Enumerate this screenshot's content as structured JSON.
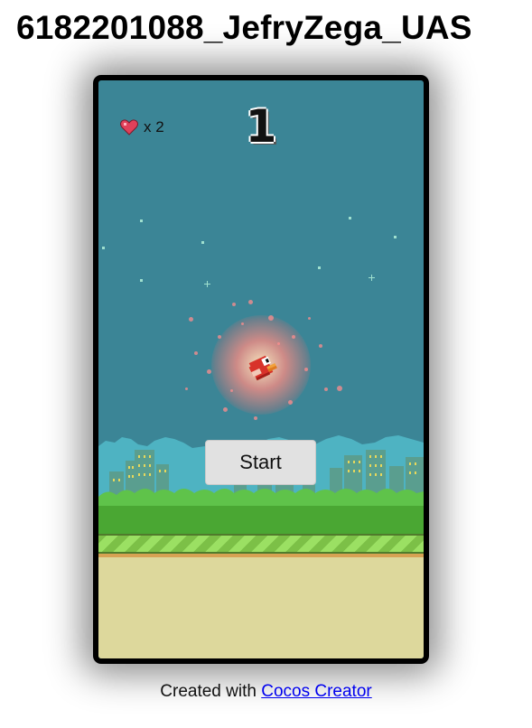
{
  "page": {
    "title": "6182201088_JefryZega_UAS"
  },
  "hud": {
    "lives_label": "x 2",
    "score": "1"
  },
  "game": {
    "start_label": "Start"
  },
  "footer": {
    "prefix": "Created with ",
    "link_text": "Cocos Creator"
  },
  "colors": {
    "sky": "#3b8596",
    "ground": "#ddd89c",
    "grass": "#4aa733",
    "stripe_light": "#9be063",
    "stripe_dark": "#7cc047",
    "link": "#0000ee"
  },
  "icons": {
    "lives": "heart-icon",
    "player": "bird-sprite"
  }
}
